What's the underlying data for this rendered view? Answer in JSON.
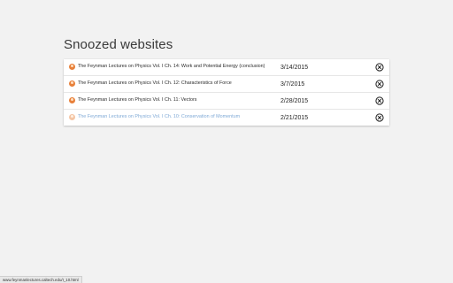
{
  "page": {
    "heading": "Snoozed websites"
  },
  "rows": [
    {
      "title": "The Feynman Lectures on Physics Vol. I Ch. 14: Work and Potential Energy (conclusion)",
      "date": "3/14/2015",
      "favicon": "feynman-favicon-icon",
      "remove_icon": "close-circle-icon"
    },
    {
      "title": "The Feynman Lectures on Physics Vol. I Ch. 12: Characteristics of Force",
      "date": "3/7/2015",
      "favicon": "feynman-favicon-icon",
      "remove_icon": "close-circle-icon"
    },
    {
      "title": "The Feynman Lectures on Physics Vol. I Ch. 11: Vectors",
      "date": "2/28/2015",
      "favicon": "feynman-favicon-icon",
      "remove_icon": "close-circle-icon"
    },
    {
      "title": "The Feynman Lectures on Physics Vol. I Ch. 10: Conservation of Momentum",
      "date": "2/21/2015",
      "favicon": "feynman-favicon-icon",
      "remove_icon": "close-circle-icon",
      "state": "hovered"
    }
  ],
  "status_bar": {
    "url": "www.feynmanlectures.caltech.edu/I_10.html"
  },
  "colors": {
    "background": "#f2f2f2",
    "card": "#ffffff",
    "hover_link": "#7fa9d6",
    "favicon": "#e8803a"
  }
}
